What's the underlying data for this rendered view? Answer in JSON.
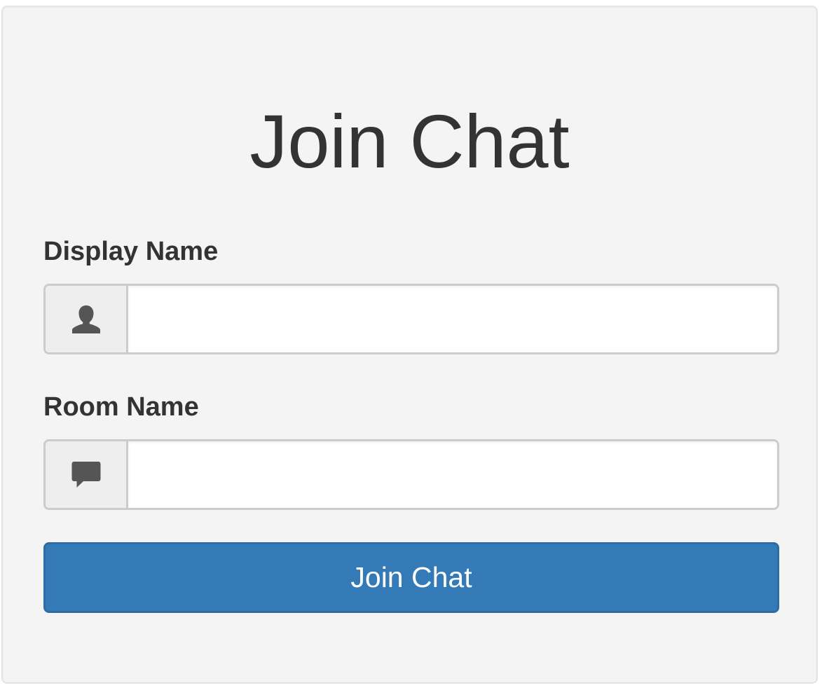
{
  "header": {
    "title": "Join Chat"
  },
  "form": {
    "display_name": {
      "label": "Display Name",
      "value": "",
      "placeholder": "",
      "icon": "user-icon"
    },
    "room_name": {
      "label": "Room Name",
      "value": "",
      "placeholder": "",
      "icon": "comment-icon"
    },
    "submit_label": "Join Chat"
  },
  "colors": {
    "panel_background": "#f4f4f4",
    "button_primary": "#337ab7",
    "text": "#333333",
    "icon": "#555555"
  }
}
